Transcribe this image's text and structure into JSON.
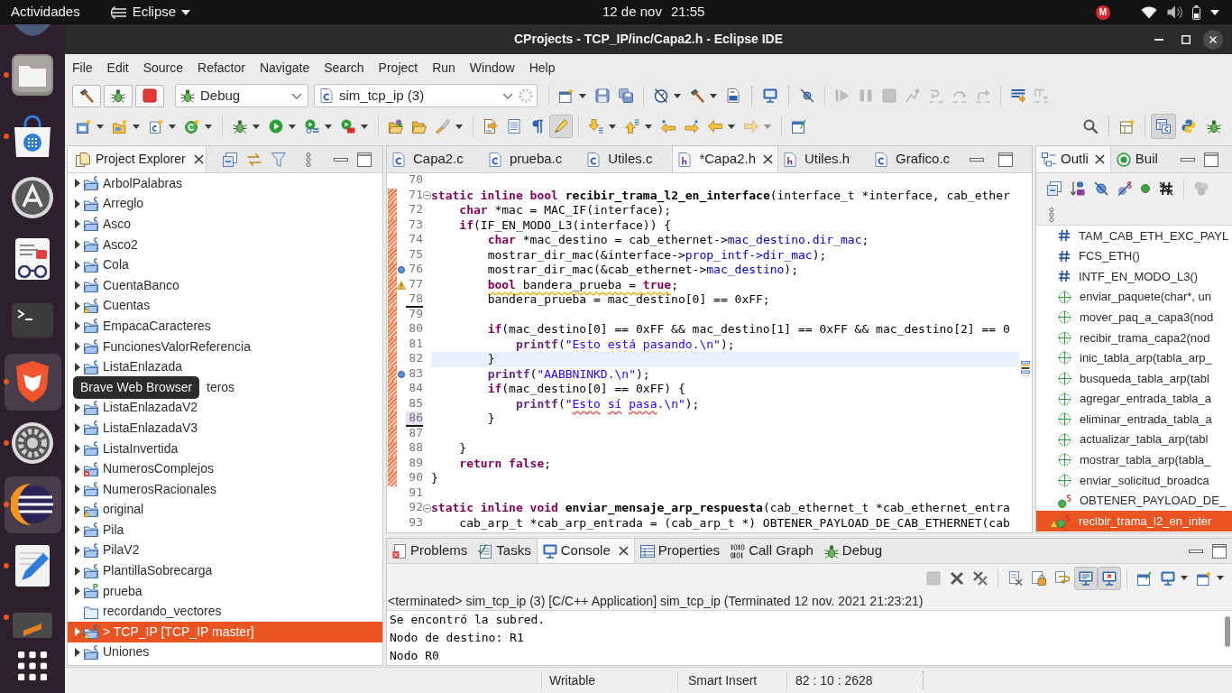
{
  "top_bar": {
    "activities": "Actividades",
    "app_menu": "Eclipse",
    "date": "12 de nov",
    "time": "21:55",
    "tray_badge": "M"
  },
  "dock": [
    {
      "kind": "round-app",
      "running": false,
      "highlighted": false
    },
    {
      "kind": "files",
      "running": true,
      "highlighted": false
    },
    {
      "kind": "software",
      "running": true,
      "highlighted": false
    },
    {
      "kind": "updater",
      "running": false,
      "highlighted": false
    },
    {
      "kind": "document-viewer",
      "running": false,
      "highlighted": false
    },
    {
      "kind": "terminal",
      "running": false,
      "highlighted": false
    },
    {
      "kind": "browser",
      "running": true,
      "highlighted": true
    },
    {
      "kind": "settings",
      "running": true,
      "highlighted": false
    },
    {
      "kind": "eclipse",
      "running": true,
      "highlighted": true
    },
    {
      "kind": "text-editor",
      "running": true,
      "highlighted": false
    },
    {
      "kind": "dark-app",
      "running": true,
      "highlighted": false
    },
    {
      "kind": "app-grid",
      "running": false,
      "highlighted": false
    }
  ],
  "window": {
    "title": "CProjects - TCP_IP/inc/Capa2.h - Eclipse IDE"
  },
  "menu": [
    "File",
    "Edit",
    "Source",
    "Refactor",
    "Navigate",
    "Search",
    "Project",
    "Run",
    "Window",
    "Help"
  ],
  "toolbar": {
    "launch_buttons": [
      {
        "kind": "build",
        "disabled": false
      },
      {
        "kind": "debug",
        "disabled": false
      },
      {
        "kind": "stop",
        "disabled": false
      }
    ],
    "build_config": "Debug",
    "launch_config": "sim_tcp_ip (3)",
    "row_1": [
      {
        "kind": "separator"
      },
      {
        "kind": "new-window",
        "disabled": false,
        "pressed": false,
        "dropdown": true
      },
      {
        "kind": "save",
        "disabled": false,
        "pressed": false,
        "dropdown": false
      },
      {
        "kind": "save-all",
        "disabled": false,
        "pressed": false,
        "dropdown": false
      },
      {
        "kind": "separator"
      },
      {
        "kind": "profile",
        "disabled": false,
        "pressed": false,
        "dropdown": true
      },
      {
        "kind": "build-all",
        "disabled": false,
        "pressed": false,
        "dropdown": true
      },
      {
        "kind": "binary",
        "disabled": false,
        "pressed": false,
        "dropdown": false
      },
      {
        "kind": "separator-dotted"
      },
      {
        "kind": "terminal-view",
        "disabled": false,
        "pressed": false,
        "dropdown": false
      },
      {
        "kind": "separator-dotted"
      },
      {
        "kind": "skip-breakpoints",
        "disabled": false,
        "pressed": false,
        "dropdown": false
      },
      {
        "kind": "separator"
      },
      {
        "kind": "resume",
        "disabled": true,
        "pressed": false,
        "dropdown": false
      },
      {
        "kind": "suspend",
        "disabled": true,
        "pressed": false,
        "dropdown": false
      },
      {
        "kind": "terminate",
        "disabled": true,
        "pressed": false,
        "dropdown": false
      },
      {
        "kind": "disconnect",
        "disabled": true,
        "pressed": false,
        "dropdown": false
      },
      {
        "kind": "step-into",
        "disabled": true,
        "pressed": false,
        "dropdown": false
      },
      {
        "kind": "step-over",
        "disabled": true,
        "pressed": false,
        "dropdown": false
      },
      {
        "kind": "step-return",
        "disabled": true,
        "pressed": false,
        "dropdown": false
      },
      {
        "kind": "separator"
      },
      {
        "kind": "instruction-step",
        "disabled": false,
        "pressed": false,
        "dropdown": false
      },
      {
        "kind": "step-filters",
        "disabled": true,
        "pressed": false,
        "dropdown": false
      }
    ],
    "row_2": [
      {
        "kind": "new-project",
        "disabled": false,
        "pressed": false,
        "dropdown": true
      },
      {
        "kind": "new-folder",
        "disabled": false,
        "pressed": false,
        "dropdown": true
      },
      {
        "kind": "new-file",
        "disabled": false,
        "pressed": false,
        "dropdown": true
      },
      {
        "kind": "new-class",
        "disabled": false,
        "pressed": false,
        "dropdown": true
      },
      {
        "kind": "separator"
      },
      {
        "kind": "debug",
        "disabled": false,
        "pressed": false,
        "dropdown": true
      },
      {
        "kind": "run",
        "disabled": false,
        "pressed": false,
        "dropdown": true
      },
      {
        "kind": "coverage",
        "disabled": false,
        "pressed": false,
        "dropdown": true
      },
      {
        "kind": "external-tools",
        "disabled": false,
        "pressed": false,
        "dropdown": true
      },
      {
        "kind": "separator"
      },
      {
        "kind": "open-type",
        "disabled": false,
        "pressed": false,
        "dropdown": false
      },
      {
        "kind": "open-element",
        "disabled": false,
        "pressed": false,
        "dropdown": false
      },
      {
        "kind": "search-text",
        "disabled": false,
        "pressed": false,
        "dropdown": true
      },
      {
        "kind": "separator"
      },
      {
        "kind": "toggle-source",
        "disabled": false,
        "pressed": false,
        "dropdown": false
      },
      {
        "kind": "block-select",
        "disabled": false,
        "pressed": false,
        "dropdown": false
      },
      {
        "kind": "whitespace",
        "disabled": false,
        "pressed": false,
        "dropdown": false
      },
      {
        "kind": "mark-occurrences",
        "disabled": false,
        "pressed": true,
        "dropdown": false
      },
      {
        "kind": "separator"
      },
      {
        "kind": "next-annotation",
        "disabled": false,
        "pressed": false,
        "dropdown": true
      },
      {
        "kind": "prev-annotation",
        "disabled": false,
        "pressed": false,
        "dropdown": true
      },
      {
        "kind": "last-edit",
        "disabled": false,
        "pressed": false,
        "dropdown": false
      },
      {
        "kind": "next-edit",
        "disabled": false,
        "pressed": false,
        "dropdown": false
      },
      {
        "kind": "back",
        "disabled": false,
        "pressed": false,
        "dropdown": true
      },
      {
        "kind": "forward",
        "disabled": true,
        "pressed": false,
        "dropdown": true
      },
      {
        "kind": "separator"
      },
      {
        "kind": "new-editor-window",
        "disabled": false,
        "pressed": false,
        "dropdown": false
      }
    ],
    "row_2_right": [
      {
        "kind": "search",
        "disabled": false,
        "pressed": false,
        "dropdown": false
      },
      {
        "kind": "separator-dotted"
      },
      {
        "kind": "open-perspective",
        "disabled": false,
        "pressed": false,
        "dropdown": false
      },
      {
        "kind": "separator"
      }
    ],
    "perspectives": [
      {
        "kind": "c-cpp",
        "selected": true
      },
      {
        "kind": "python",
        "selected": false
      },
      {
        "kind": "debug",
        "selected": false
      }
    ]
  },
  "project_explorer": {
    "title": "Project Explorer",
    "items": [
      {
        "label": "ArbolPalabras",
        "kind": "c-project",
        "has_warning": false,
        "has_error": false,
        "expandable": true,
        "selected": false
      },
      {
        "label": "Arreglo",
        "kind": "c-project",
        "has_warning": false,
        "has_error": false,
        "expandable": true,
        "selected": false
      },
      {
        "label": "Asco",
        "kind": "c-project",
        "has_warning": false,
        "has_error": false,
        "expandable": true,
        "selected": false
      },
      {
        "label": "Asco2",
        "kind": "c-project",
        "has_warning": false,
        "has_error": false,
        "expandable": true,
        "selected": false
      },
      {
        "label": "Cola",
        "kind": "c-project",
        "has_warning": false,
        "has_error": false,
        "expandable": true,
        "selected": false
      },
      {
        "label": "CuentaBanco",
        "kind": "c-project",
        "has_warning": false,
        "has_error": false,
        "expandable": true,
        "selected": false
      },
      {
        "label": "Cuentas",
        "kind": "c-project",
        "has_warning": true,
        "has_error": false,
        "expandable": true,
        "selected": false
      },
      {
        "label": "EmpacaCaracteres",
        "kind": "c-project",
        "has_warning": false,
        "has_error": false,
        "expandable": true,
        "selected": false
      },
      {
        "label": "FuncionesValorReferencia",
        "kind": "c-project",
        "has_warning": false,
        "has_error": false,
        "expandable": true,
        "selected": false
      },
      {
        "label": "ListaEnlazada",
        "kind": "c-project",
        "has_warning": false,
        "has_error": false,
        "expandable": true,
        "selected": false
      },
      {
        "label": "teros",
        "kind": "covered",
        "selected": false
      },
      {
        "label": "ListaEnlazadaV2",
        "kind": "c-project",
        "has_warning": false,
        "has_error": false,
        "expandable": true,
        "selected": false
      },
      {
        "label": "ListaEnlazadaV3",
        "kind": "c-project",
        "has_warning": false,
        "has_error": false,
        "expandable": true,
        "selected": false
      },
      {
        "label": "ListaInvertida",
        "kind": "c-project",
        "has_warning": false,
        "has_error": false,
        "expandable": true,
        "selected": false
      },
      {
        "label": "NumerosComplejos",
        "kind": "c-project",
        "has_warning": false,
        "has_error": true,
        "expandable": true,
        "selected": false
      },
      {
        "label": "NumerosRacionales",
        "kind": "c-project",
        "has_warning": false,
        "has_error": false,
        "expandable": true,
        "selected": false
      },
      {
        "label": "original",
        "kind": "c-project",
        "has_warning": true,
        "has_error": false,
        "expandable": true,
        "selected": false
      },
      {
        "label": "Pila",
        "kind": "c-project",
        "has_warning": false,
        "has_error": false,
        "expandable": true,
        "selected": false
      },
      {
        "label": "PilaV2",
        "kind": "c-project",
        "has_warning": false,
        "has_error": false,
        "expandable": true,
        "selected": false
      },
      {
        "label": "PlantillaSobrecarga",
        "kind": "c-project",
        "has_warning": false,
        "has_error": false,
        "expandable": true,
        "selected": false
      },
      {
        "label": "prueba",
        "kind": "python-project",
        "has_warning": false,
        "has_error": false,
        "expandable": true,
        "selected": false
      },
      {
        "label": "recordando_vectores",
        "kind": "folder",
        "has_warning": false,
        "has_error": false,
        "expandable": false,
        "selected": false
      },
      {
        "label": "> TCP_IP [TCP_IP master]",
        "kind": "c-project",
        "has_warning": true,
        "has_error": false,
        "expandable": true,
        "selected": true
      },
      {
        "label": "Uniones",
        "kind": "c-project",
        "has_warning": false,
        "has_error": false,
        "expandable": true,
        "selected": false
      }
    ]
  },
  "tooltip": "Brave Web Browser",
  "editor": {
    "tabs": [
      {
        "label": "Capa2.c",
        "kind": "c",
        "selected": false
      },
      {
        "label": "prueba.c",
        "kind": "c",
        "selected": false
      },
      {
        "label": "Utiles.c",
        "kind": "c",
        "selected": false
      },
      {
        "label": "*Capa2.h",
        "kind": "h",
        "selected": true
      },
      {
        "label": "Utiles.h",
        "kind": "h",
        "selected": false
      },
      {
        "label": "Grafico.c",
        "kind": "c",
        "selected": false
      }
    ],
    "lines": [
      {
        "number": "70",
        "changed": false,
        "current": false,
        "fold": false,
        "info_marker": false,
        "warning_marker": false,
        "deleted_below": false,
        "number_highlight": false
      },
      {
        "number": "71",
        "changed": true,
        "current": false,
        "fold": true,
        "info_marker": false,
        "warning_marker": false,
        "deleted_below": false,
        "number_highlight": false,
        "tokens": [
          {
            "text": "static",
            "kind": "keyword"
          },
          {
            "text": " inline",
            "kind": "keyword"
          },
          {
            "text": " bool",
            "kind": "keyword"
          },
          {
            "text": " recibir_trama_l2_en_interface",
            "kind": "function"
          },
          {
            "text": "(interface_t *interface, cab_ether",
            "kind": "plain"
          }
        ]
      },
      {
        "number": "72",
        "changed": true,
        "current": false,
        "fold": false,
        "info_marker": false,
        "warning_marker": false,
        "deleted_below": false,
        "number_highlight": false,
        "tokens": [
          {
            "text": "    char",
            "kind": "keyword"
          },
          {
            "text": " *mac = MAC_IF(interface);",
            "kind": "plain"
          }
        ]
      },
      {
        "number": "73",
        "changed": true,
        "current": false,
        "fold": false,
        "info_marker": false,
        "warning_marker": false,
        "deleted_below": false,
        "number_highlight": false,
        "tokens": [
          {
            "text": "    if",
            "kind": "keyword"
          },
          {
            "text": "(IF_EN_MODO_L3(interface)) {",
            "kind": "plain"
          }
        ]
      },
      {
        "number": "74",
        "changed": true,
        "current": false,
        "fold": false,
        "info_marker": false,
        "warning_marker": false,
        "deleted_below": false,
        "number_highlight": false,
        "tokens": [
          {
            "text": "        char",
            "kind": "keyword"
          },
          {
            "text": " *mac_destino = cab_ethernet->",
            "kind": "plain"
          },
          {
            "text": "mac_destino.dir_mac",
            "kind": "field"
          },
          {
            "text": ";",
            "kind": "plain"
          }
        ]
      },
      {
        "number": "75",
        "changed": true,
        "current": false,
        "fold": false,
        "info_marker": false,
        "warning_marker": false,
        "deleted_below": false,
        "number_highlight": false,
        "tokens": [
          {
            "text": "        mostrar_dir_mac(&interface->",
            "kind": "plain"
          },
          {
            "text": "prop_intf->dir_mac",
            "kind": "field"
          },
          {
            "text": ");",
            "kind": "plain"
          }
        ]
      },
      {
        "number": "76",
        "changed": true,
        "current": false,
        "fold": false,
        "info_marker": true,
        "warning_marker": false,
        "deleted_below": false,
        "number_highlight": false,
        "tokens": [
          {
            "text": "        mostrar_dir_mac(&cab_ethernet->",
            "kind": "plain"
          },
          {
            "text": "mac_destino",
            "kind": "field"
          },
          {
            "text": ");",
            "kind": "plain"
          }
        ]
      },
      {
        "number": "77",
        "changed": true,
        "current": false,
        "fold": false,
        "info_marker": false,
        "warning_marker": true,
        "deleted_below": false,
        "number_highlight": false,
        "tokens": [
          {
            "text": "        bool",
            "kind": "keyword",
            "warning_squiggle": true
          },
          {
            "text": " bandera_prueba = ",
            "kind": "plain",
            "warning_squiggle": true
          },
          {
            "text": "true",
            "kind": "keyword",
            "warning_squiggle": true
          },
          {
            "text": ";",
            "kind": "plain"
          }
        ]
      },
      {
        "number": "78",
        "changed": true,
        "current": false,
        "fold": false,
        "info_marker": false,
        "warning_marker": false,
        "deleted_below": true,
        "number_highlight": false,
        "tokens": [
          {
            "text": "        bandera_prueba = mac_destino[0] == 0xFF;",
            "kind": "plain"
          }
        ]
      },
      {
        "number": "79",
        "changed": true,
        "current": false,
        "fold": false,
        "info_marker": false,
        "warning_marker": false,
        "deleted_below": false,
        "number_highlight": false
      },
      {
        "number": "80",
        "changed": true,
        "current": false,
        "fold": false,
        "info_marker": false,
        "warning_marker": false,
        "deleted_below": false,
        "number_highlight": false,
        "tokens": [
          {
            "text": "        if",
            "kind": "keyword"
          },
          {
            "text": "(mac_destino[0] == 0xFF && mac_destino[1] == 0xFF && mac_destino[2] == 0",
            "kind": "plain"
          }
        ]
      },
      {
        "number": "81",
        "changed": true,
        "current": false,
        "fold": false,
        "info_marker": false,
        "warning_marker": false,
        "deleted_below": false,
        "number_highlight": false,
        "tokens": [
          {
            "text": "            printf",
            "kind": "call"
          },
          {
            "text": "(",
            "kind": "plain"
          },
          {
            "text": "\"",
            "kind": "string"
          },
          {
            "text": "Esto",
            "kind": "string",
            "spelling_squiggle": true
          },
          {
            "text": " está",
            "kind": "string",
            "spelling_squiggle": true
          },
          {
            "text": " pasando",
            "kind": "string",
            "spelling_squiggle": true
          },
          {
            "text": ".\\n\"",
            "kind": "string"
          },
          {
            "text": ");",
            "kind": "plain"
          }
        ]
      },
      {
        "number": "82",
        "changed": true,
        "current": true,
        "fold": false,
        "info_marker": false,
        "warning_marker": false,
        "deleted_below": false,
        "number_highlight": false,
        "tokens": [
          {
            "text": "        }",
            "kind": "plain"
          }
        ]
      },
      {
        "number": "83",
        "changed": true,
        "current": false,
        "fold": false,
        "info_marker": true,
        "warning_marker": false,
        "deleted_below": false,
        "number_highlight": false,
        "tokens": [
          {
            "text": "        printf",
            "kind": "call"
          },
          {
            "text": "(",
            "kind": "plain"
          },
          {
            "text": "\"AABBNINKD.\\n\"",
            "kind": "string"
          },
          {
            "text": ");",
            "kind": "plain"
          }
        ]
      },
      {
        "number": "84",
        "changed": true,
        "current": false,
        "fold": false,
        "info_marker": false,
        "warning_marker": false,
        "deleted_below": false,
        "number_highlight": false,
        "tokens": [
          {
            "text": "        if",
            "kind": "keyword"
          },
          {
            "text": "(mac_destino[0] == 0xFF) {",
            "kind": "plain"
          }
        ]
      },
      {
        "number": "85",
        "changed": true,
        "current": false,
        "fold": false,
        "info_marker": false,
        "warning_marker": false,
        "deleted_below": false,
        "number_highlight": false,
        "tokens": [
          {
            "text": "            printf",
            "kind": "call"
          },
          {
            "text": "(",
            "kind": "plain"
          },
          {
            "text": "\"",
            "kind": "string"
          },
          {
            "text": "Esto",
            "kind": "string",
            "spelling_squiggle": true
          },
          {
            "text": " sí",
            "kind": "string",
            "spelling_squiggle": true
          },
          {
            "text": " pasa",
            "kind": "string",
            "spelling_squiggle": true
          },
          {
            "text": ".\\n\"",
            "kind": "string"
          },
          {
            "text": ");",
            "kind": "plain"
          }
        ]
      },
      {
        "number": "86",
        "changed": true,
        "current": false,
        "fold": false,
        "info_marker": false,
        "warning_marker": false,
        "deleted_below": true,
        "number_highlight": true,
        "tokens": [
          {
            "text": "        }",
            "kind": "plain"
          }
        ]
      },
      {
        "number": "87",
        "changed": true,
        "current": false,
        "fold": false,
        "info_marker": false,
        "warning_marker": false,
        "deleted_below": false,
        "number_highlight": false
      },
      {
        "number": "88",
        "changed": true,
        "current": false,
        "fold": false,
        "info_marker": false,
        "warning_marker": false,
        "deleted_below": false,
        "number_highlight": false,
        "tokens": [
          {
            "text": "    }",
            "kind": "plain"
          }
        ]
      },
      {
        "number": "89",
        "changed": true,
        "current": false,
        "fold": false,
        "info_marker": false,
        "warning_marker": false,
        "deleted_below": false,
        "number_highlight": false,
        "tokens": [
          {
            "text": "    return",
            "kind": "keyword"
          },
          {
            "text": " false",
            "kind": "keyword"
          },
          {
            "text": ";",
            "kind": "plain"
          }
        ]
      },
      {
        "number": "90",
        "changed": true,
        "current": false,
        "fold": false,
        "info_marker": false,
        "warning_marker": false,
        "deleted_below": false,
        "number_highlight": false,
        "tokens": [
          {
            "text": "}",
            "kind": "plain"
          }
        ]
      },
      {
        "number": "91",
        "changed": false,
        "current": false,
        "fold": false,
        "info_marker": false,
        "warning_marker": false,
        "deleted_below": false,
        "number_highlight": false
      },
      {
        "number": "92",
        "changed": false,
        "current": false,
        "fold": true,
        "info_marker": false,
        "warning_marker": false,
        "deleted_below": false,
        "number_highlight": false,
        "tokens": [
          {
            "text": "static",
            "kind": "keyword"
          },
          {
            "text": " inline",
            "kind": "keyword"
          },
          {
            "text": " void",
            "kind": "keyword"
          },
          {
            "text": " enviar_mensaje_arp_respuesta",
            "kind": "function"
          },
          {
            "text": "(cab_ethernet_t *cab_ethernet_entra",
            "kind": "plain"
          }
        ]
      },
      {
        "number": "93",
        "changed": false,
        "current": false,
        "fold": false,
        "info_marker": false,
        "warning_marker": false,
        "deleted_below": false,
        "number_highlight": false,
        "tokens": [
          {
            "text": "    cab_arp_t *cab_arp_entrada = (cab_arp_t *) OBTENER_PAYLOAD_DE_CAB_ETHERNET(cab",
            "kind": "plain"
          }
        ]
      }
    ]
  },
  "outline": {
    "tabs": [
      {
        "label": "Outli",
        "kind": "outline",
        "selected": true
      },
      {
        "label": "Buil",
        "kind": "build-targets",
        "selected": false
      }
    ],
    "toolbar": [
      {
        "kind": "collapse-all",
        "disabled": false,
        "pressed": false,
        "dropdown": false
      },
      {
        "kind": "sort",
        "disabled": false,
        "pressed": false,
        "dropdown": false
      },
      {
        "kind": "hide-fields",
        "disabled": false,
        "pressed": false,
        "dropdown": false
      },
      {
        "kind": "hide-static",
        "disabled": false,
        "pressed": false,
        "dropdown": false
      },
      {
        "kind": "hide-non-public",
        "disabled": false,
        "pressed": false,
        "dropdown": false
      },
      {
        "kind": "hide-macros",
        "disabled": false,
        "pressed": false,
        "dropdown": false
      },
      {
        "kind": "separator"
      },
      {
        "kind": "group",
        "disabled": true,
        "pressed": false,
        "dropdown": false
      }
    ],
    "items": [
      {
        "label": "TAM_CAB_ETH_EXC_PAYL",
        "kind": "macro",
        "selected": false,
        "warning": false
      },
      {
        "label": "FCS_ETH()",
        "kind": "macro",
        "selected": false,
        "warning": false
      },
      {
        "label": "INTF_EN_MODO_L3()",
        "kind": "macro",
        "selected": false,
        "warning": false
      },
      {
        "label": "enviar_paquete(char*, un",
        "kind": "function",
        "selected": false,
        "warning": false
      },
      {
        "label": "mover_paq_a_capa3(nod",
        "kind": "function",
        "selected": false,
        "warning": false
      },
      {
        "label": "recibir_trama_capa2(nod",
        "kind": "function",
        "selected": false,
        "warning": false
      },
      {
        "label": "inic_tabla_arp(tabla_arp_",
        "kind": "function",
        "selected": false,
        "warning": false
      },
      {
        "label": "busqueda_tabla_arp(tabl",
        "kind": "function",
        "selected": false,
        "warning": false
      },
      {
        "label": "agregar_entrada_tabla_a",
        "kind": "function",
        "selected": false,
        "warning": false
      },
      {
        "label": "eliminar_entrada_tabla_a",
        "kind": "function",
        "selected": false,
        "warning": false
      },
      {
        "label": "actualizar_tabla_arp(tabl",
        "kind": "function",
        "selected": false,
        "warning": false
      },
      {
        "label": "mostrar_tabla_arp(tabla_",
        "kind": "function",
        "selected": false,
        "warning": false
      },
      {
        "label": "enviar_solicitud_broadca",
        "kind": "function",
        "selected": false,
        "warning": false
      },
      {
        "label": "OBTENER_PAYLOAD_DE_",
        "kind": "static-function",
        "selected": false,
        "warning": false
      },
      {
        "label": "recibir_trama_l2_en_inter",
        "kind": "static-function",
        "selected": true,
        "warning": true
      }
    ]
  },
  "bottom_panel": {
    "tabs": [
      {
        "label": "Problems",
        "kind": "problems",
        "selected": false
      },
      {
        "label": "Tasks",
        "kind": "tasks",
        "selected": false
      },
      {
        "label": "Console",
        "kind": "console",
        "selected": true
      },
      {
        "label": "Properties",
        "kind": "properties",
        "selected": false
      },
      {
        "label": "Call Graph",
        "kind": "call-graph",
        "selected": false
      },
      {
        "label": "Debug",
        "kind": "debug",
        "selected": false
      }
    ],
    "toolbar": [
      {
        "kind": "terminate",
        "disabled": true,
        "pressed": false,
        "dropdown": false
      },
      {
        "kind": "remove-launch",
        "disabled": false,
        "pressed": false,
        "dropdown": false
      },
      {
        "kind": "remove-all",
        "disabled": false,
        "pressed": false,
        "dropdown": false
      },
      {
        "kind": "separator"
      },
      {
        "kind": "clear",
        "disabled": false,
        "pressed": false,
        "dropdown": false
      },
      {
        "kind": "scroll-lock",
        "disabled": false,
        "pressed": false,
        "dropdown": false
      },
      {
        "kind": "word-wrap",
        "disabled": false,
        "pressed": false,
        "dropdown": false
      },
      {
        "kind": "stdout",
        "disabled": false,
        "pressed": true,
        "dropdown": false
      },
      {
        "kind": "stderr",
        "disabled": false,
        "pressed": true,
        "dropdown": false
      },
      {
        "kind": "separator"
      },
      {
        "kind": "pin",
        "disabled": false,
        "pressed": false,
        "dropdown": false
      },
      {
        "kind": "display-console",
        "disabled": false,
        "pressed": false,
        "dropdown": true
      },
      {
        "kind": "open-console",
        "disabled": false,
        "pressed": false,
        "dropdown": true
      }
    ],
    "console_header": "<terminated> sim_tcp_ip (3) [C/C++ Application] sim_tcp_ip (Terminated 12 nov. 2021 21:23:21)",
    "output": [
      "Se encontró la subred.",
      "Nodo de destino: R1",
      "Nodo R0"
    ]
  },
  "status_bar": [
    "Writable",
    "Smart Insert",
    "82 : 10 : 2628"
  ]
}
